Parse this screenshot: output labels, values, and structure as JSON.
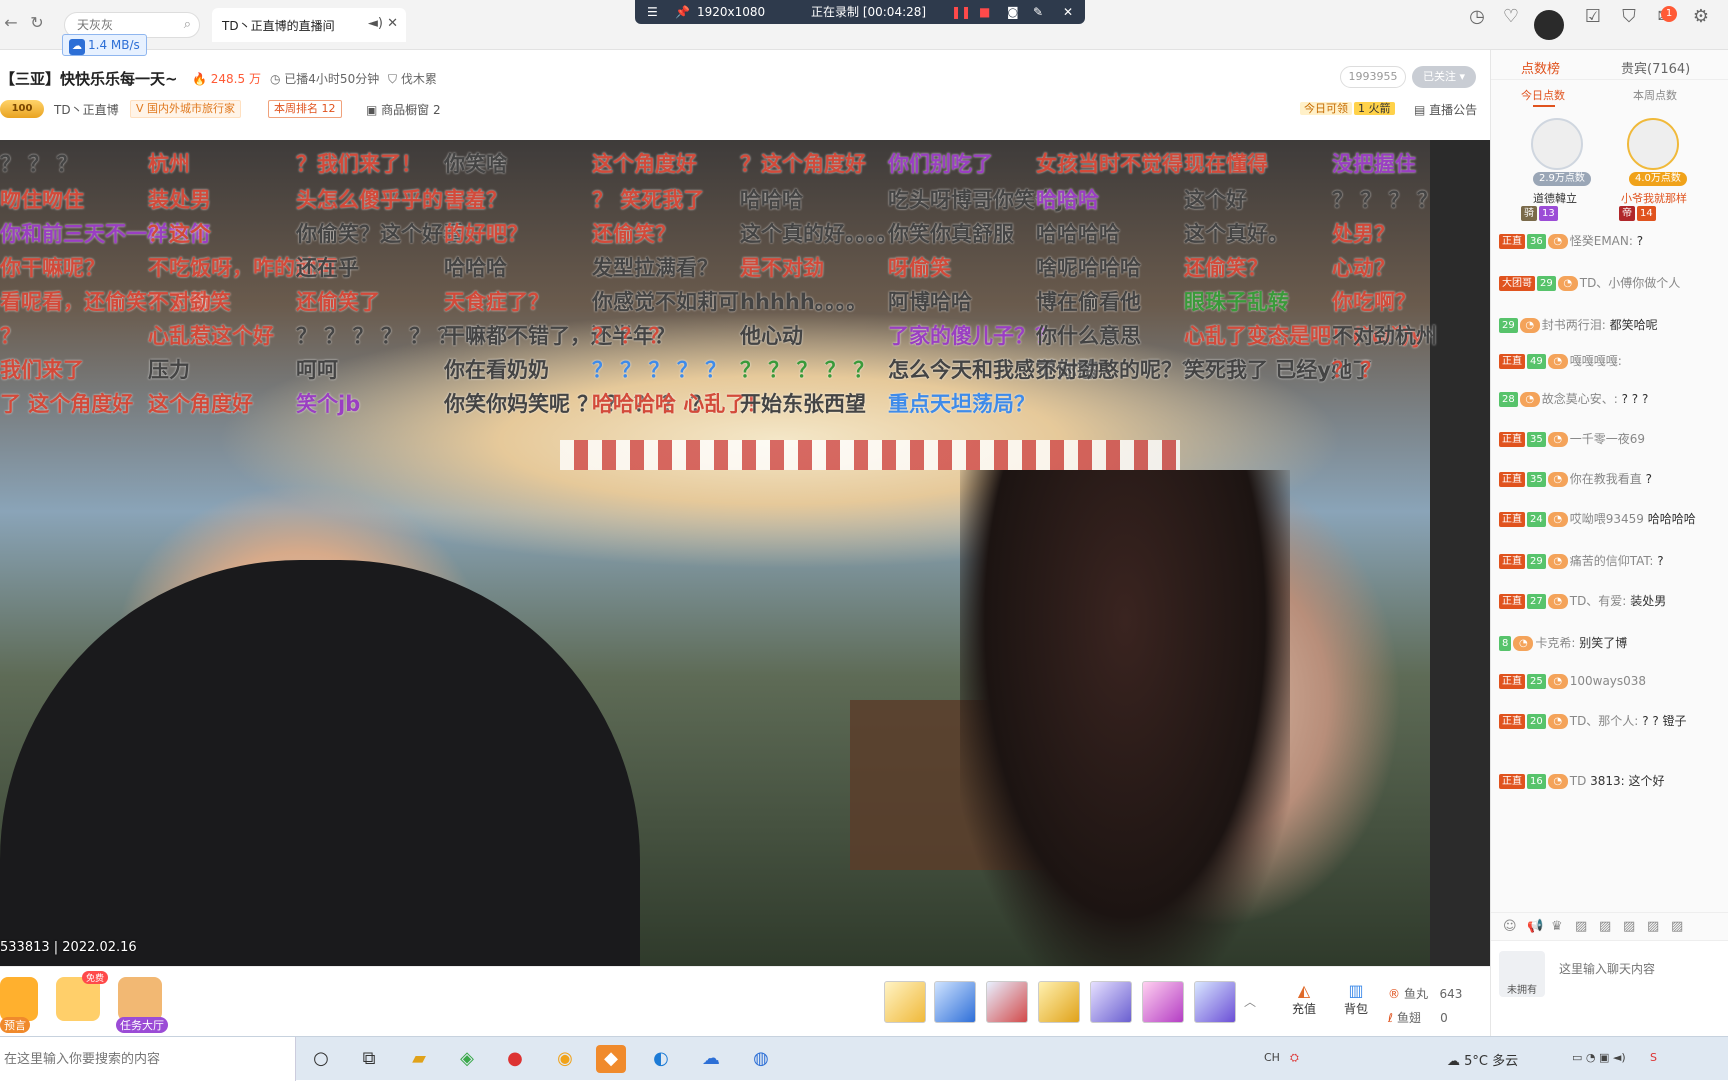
{
  "browser": {
    "search_placeholder": "天灰灰",
    "speed": "1.4 MB/s",
    "tab_title": "TD丶正直博的直播间"
  },
  "recorder": {
    "resolution": "1920x1080",
    "status": "正在录制 [00:04:28]"
  },
  "top_icons": {
    "notification_count": "1"
  },
  "room": {
    "title": "【三亚】快快乐乐每一天~",
    "heat": "248.5 万",
    "live_duration": "已播4小时50分钟",
    "subtitle": "伐木累",
    "room_id": "1993955",
    "follow_label": "已关注",
    "level": "100",
    "streamer": "TD丶正直博",
    "category": "国内外城市旅行家",
    "weekly_rank": "本周排名 12",
    "shop": "商品橱窗 2",
    "claim_label": "今日可领",
    "claim_value": "1 火箭",
    "notice": "直播公告"
  },
  "video": {
    "watermark": "533813 | 2022.02.16",
    "danmaku": [
      {
        "t": "？ ？ ？",
        "c": "#444"
      },
      {
        "t": "杭州",
        "c": "#d34a3a"
      },
      {
        "t": "？我们来了！",
        "c": "#d34a3a"
      },
      {
        "t": "你笑啥",
        "c": "#444"
      },
      {
        "t": "这个角度好",
        "c": "#d34a3a"
      },
      {
        "t": "？这个角度好",
        "c": "#d34a3a"
      },
      {
        "t": "你们别吃了",
        "c": "#9a3fc2"
      },
      {
        "t": "女孩当时不觉得",
        "c": "#d34a3a"
      },
      {
        "t": "现在懂得",
        "c": "#d34a3a"
      },
      {
        "t": "没把握住",
        "c": "#9a3fc2"
      },
      {
        "t": "吻住吻住",
        "c": "#d34a3a"
      },
      {
        "t": "装处男",
        "c": "#d34a3a"
      },
      {
        "t": "头怎么傻乎乎的",
        "c": "#d34a3a"
      },
      {
        "t": "害羞？",
        "c": "#d34a3a"
      },
      {
        "t": "？ 笑死我了",
        "c": "#d34a3a"
      },
      {
        "t": "哈哈哈",
        "c": "#444"
      },
      {
        "t": "吃头呀博哥你笑个jb",
        "c": "#444"
      },
      {
        "t": "哈哈哈",
        "c": "#9a3fc2"
      },
      {
        "t": "这个好",
        "c": "#444"
      },
      {
        "t": "？ ？ ？ ？",
        "c": "#444"
      },
      {
        "t": "你和前三天不一样为何",
        "c": "#9a3fc2"
      },
      {
        "t": "？这个",
        "c": "#d34a3a"
      },
      {
        "t": "你偷笑？这个好看",
        "c": "#444"
      },
      {
        "t": "的好吧？",
        "c": "#d34a3a"
      },
      {
        "t": "还偷笑？",
        "c": "#d34a3a"
      },
      {
        "t": "这个真的好。。。。",
        "c": "#444"
      },
      {
        "t": "你笑你真舒服",
        "c": "#444"
      },
      {
        "t": "哈哈哈哈",
        "c": "#444"
      },
      {
        "t": "这个真好。",
        "c": "#444"
      },
      {
        "t": "处男？",
        "c": "#d34a3a"
      },
      {
        "t": "你干嘛呢？",
        "c": "#d34a3a"
      },
      {
        "t": "不吃饭呀，咋的就可",
        "c": "#d34a3a"
      },
      {
        "t": "还在乎",
        "c": "#444"
      },
      {
        "t": "哈哈哈",
        "c": "#444"
      },
      {
        "t": "发型拉满看？",
        "c": "#444"
      },
      {
        "t": "是不对劲",
        "c": "#d34a3a"
      },
      {
        "t": "呀偷笑",
        "c": "#d34a3a"
      },
      {
        "t": "啥呢哈哈哈",
        "c": "#444"
      },
      {
        "t": "还偷笑？",
        "c": "#d34a3a"
      },
      {
        "t": "心动？",
        "c": "#d34a3a"
      },
      {
        "t": "看呢看，还偷笑？了偷笑",
        "c": "#d34a3a"
      },
      {
        "t": "不对劲",
        "c": "#d34a3a"
      },
      {
        "t": "还偷笑了",
        "c": "#d34a3a"
      },
      {
        "t": "天食症了？",
        "c": "#d34a3a"
      },
      {
        "t": "你感觉不如莉可",
        "c": "#444"
      },
      {
        "t": "hhhhh。。。。",
        "c": "#444"
      },
      {
        "t": "阿博哈哈",
        "c": "#444"
      },
      {
        "t": "博在偷看他",
        "c": "#444"
      },
      {
        "t": "眼珠子乱转",
        "c": "#3a9a3a"
      },
      {
        "t": "你吃啊？",
        "c": "#d34a3a"
      },
      {
        "t": "？",
        "c": "#d34a3a"
      },
      {
        "t": "心乱惹这个好",
        "c": "#d34a3a"
      },
      {
        "t": "？ ？ ？ ？ ？ ？ ？ ？",
        "c": "#444"
      },
      {
        "t": "干嘛都不错了，还半年？",
        "c": "#444"
      },
      {
        "t": "？ ？ ？",
        "c": "#d34a3a"
      },
      {
        "t": "他心动",
        "c": "#444"
      },
      {
        "t": "了家的傻儿子？？",
        "c": "#9a3fc2"
      },
      {
        "t": "你什么意思",
        "c": "#444"
      },
      {
        "t": "心乱了变态是吧！(ˇωˇ)y",
        "c": "#d34a3a"
      },
      {
        "t": "不对劲杭州",
        "c": "#444"
      },
      {
        "t": "我们来了",
        "c": "#d34a3a"
      },
      {
        "t": "压力",
        "c": "#444"
      },
      {
        "t": "呵呵",
        "c": "#444"
      },
      {
        "t": "你在看奶奶",
        "c": "#444"
      },
      {
        "t": "？ ？ ？ ？ ？",
        "c": "#3f8be9"
      },
      {
        "t": "？ ？ ？ ？ ？",
        "c": "#3a9a3a"
      },
      {
        "t": "怎么今天和我感觉你憨憨的呢？？",
        "c": "#444"
      },
      {
        "t": "不对劲",
        "c": "#444"
      },
      {
        "t": "笑死我了 已经y她了",
        "c": "#444"
      },
      {
        "t": "？ ？",
        "c": "#d34a3a"
      },
      {
        "t": "了 这个角度好",
        "c": "#d34a3a"
      },
      {
        "t": "这个角度好",
        "c": "#d34a3a"
      },
      {
        "t": "笑个jb",
        "c": "#9a3fc2"
      },
      {
        "t": "你笑你妈笑呢 ？ ？ ？ ？ ？",
        "c": "#444"
      },
      {
        "t": "哈哈哈哈 心乱了！",
        "c": "#d34a3a"
      },
      {
        "t": "开始东张西望",
        "c": "#444"
      },
      {
        "t": "重点天坦荡局？",
        "c": "#3f8be9"
      }
    ]
  },
  "bottom": {
    "btn_preview": "预言",
    "btn_gift_badge": "免费",
    "btn_task": "任务大厅",
    "recharge": "充值",
    "backpack": "背包",
    "fish_ball_label": "鱼丸",
    "fish_ball_value": "643",
    "fish_wing_label": "鱼翅",
    "fish_wing_value": "0"
  },
  "right_panel": {
    "tab_points": "点数榜",
    "tab_vip": "贵宾(7164)",
    "sub_today": "今日点数",
    "sub_week": "本周点数",
    "rank": [
      {
        "pts": "2.9万点数",
        "name": "道德韓立",
        "lv": "13"
      },
      {
        "pts": "4.0万点数",
        "name": "小爷我就那样",
        "lv": "14"
      }
    ],
    "chat": [
      {
        "lv": "正直",
        "fan": "36",
        "user": "怪癸EMAN:",
        "text": "?"
      },
      {
        "lv": "大团哥",
        "fan": "29",
        "user": "TD、小傅你做个人",
        "text": ""
      },
      {
        "lv": "",
        "fan": "29",
        "user": "封书两行泪:",
        "text": "都笑哈呢"
      },
      {
        "lv": "正直",
        "fan": "49",
        "user": "嘎嘎嘎嘎:",
        "text": ""
      },
      {
        "lv": "",
        "fan": "28",
        "user": "故念莫心安、:",
        "text": "? ? ?"
      },
      {
        "lv": "正直",
        "fan": "35",
        "user": "一千零一夜69",
        "text": ""
      },
      {
        "lv": "正直",
        "fan": "35",
        "user": "你在教我看直",
        "text": "?"
      },
      {
        "lv": "正直",
        "fan": "24",
        "user": "哎呦喂93459",
        "text": "哈哈哈哈"
      },
      {
        "lv": "正直",
        "fan": "29",
        "user": "痛苦的信仰TAT:",
        "text": "?"
      },
      {
        "lv": "正直",
        "fan": "27",
        "user": "TD、有爱:",
        "text": "装处男"
      },
      {
        "lv": "",
        "fan": "8",
        "user": "卡克希:",
        "text": "别笑了博"
      },
      {
        "lv": "正直",
        "fan": "25",
        "user": "100ways038",
        "text": ""
      },
      {
        "lv": "正直",
        "fan": "20",
        "user": "TD、那个人:",
        "text": "? ? 镫子"
      },
      {
        "lv": "正直",
        "fan": "16",
        "user": "TD",
        "text": "3813: 这个好"
      }
    ],
    "chat_avatar_label": "未拥有",
    "chat_placeholder": "这里输入聊天内容"
  },
  "taskbar": {
    "search_placeholder": "在这里输入你要搜索的内容",
    "weather": "5°C 多云"
  },
  "colors": {
    "accent": "#e0531e",
    "recbar": "#2e3a4c"
  }
}
